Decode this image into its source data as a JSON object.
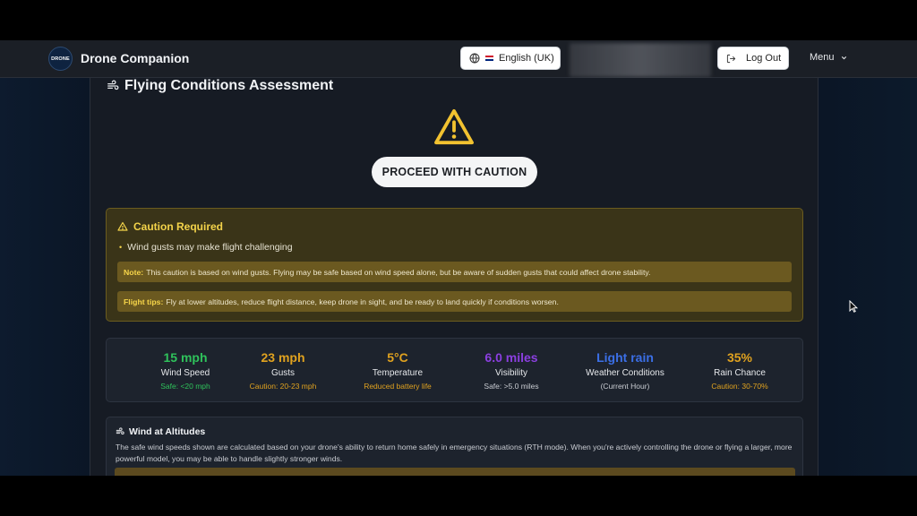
{
  "navbar": {
    "logo_text": "DRONE",
    "brand": "Drone Companion",
    "language_label": "English (UK)",
    "logout_label": "Log Out",
    "menu_label": "Menu"
  },
  "assessment": {
    "title": "Flying Conditions Assessment",
    "status": "PROCEED WITH CAUTION",
    "caution_heading": "Caution Required",
    "caution_items": [
      "Wind gusts may make flight challenging"
    ],
    "note_label": "Note:",
    "note_text": "This caution is based on wind gusts. Flying may be safe based on wind speed alone, but be aware of sudden gusts that could affect drone stability.",
    "tips_label": "Flight tips:",
    "tips_text": "Fly at lower altitudes, reduce flight distance, keep drone in sight, and be ready to land quickly if conditions worsen."
  },
  "stats": [
    {
      "value": "15 mph",
      "label": "Wind Speed",
      "sub": "Safe: <20 mph",
      "value_color": "#2fc25b",
      "sub_color": "#2fc25b"
    },
    {
      "value": "23 mph",
      "label": "Gusts",
      "sub": "Caution: 20-23 mph",
      "value_color": "#e0a21f",
      "sub_color": "#e0a21f"
    },
    {
      "value": "5°C",
      "label": "Temperature",
      "sub": "Reduced battery life",
      "value_color": "#e0a21f",
      "sub_color": "#e0a21f"
    },
    {
      "value": "6.0 miles",
      "label": "Visibility",
      "sub": "Safe: >5.0 miles",
      "value_color": "#8b3fe0",
      "sub_color": "#c9ccd2"
    },
    {
      "value": "Light rain",
      "label": "Weather Conditions",
      "sub": "(Current Hour)",
      "value_color": "#3b6fe6",
      "sub_color": "#c9ccd2"
    },
    {
      "value": "35%",
      "label": "Rain Chance",
      "sub": "Caution: 30-70%",
      "value_color": "#e0a21f",
      "sub_color": "#e0a21f"
    }
  ],
  "altitudes": {
    "title": "Wind at Altitudes",
    "description": "The safe wind speeds shown are calculated based on your drone's ability to return home safely in emergency situations (RTH mode). When you're actively controlling the drone or flying a larger, more powerful model, you may be able to handle slightly stronger winds."
  },
  "icons": {
    "wind": "wind-icon",
    "warning": "warning-triangle-icon",
    "globe": "globe-icon",
    "logout": "logout-icon",
    "chevron": "chevron-down-icon",
    "cursor": "mouse-cursor-icon"
  }
}
